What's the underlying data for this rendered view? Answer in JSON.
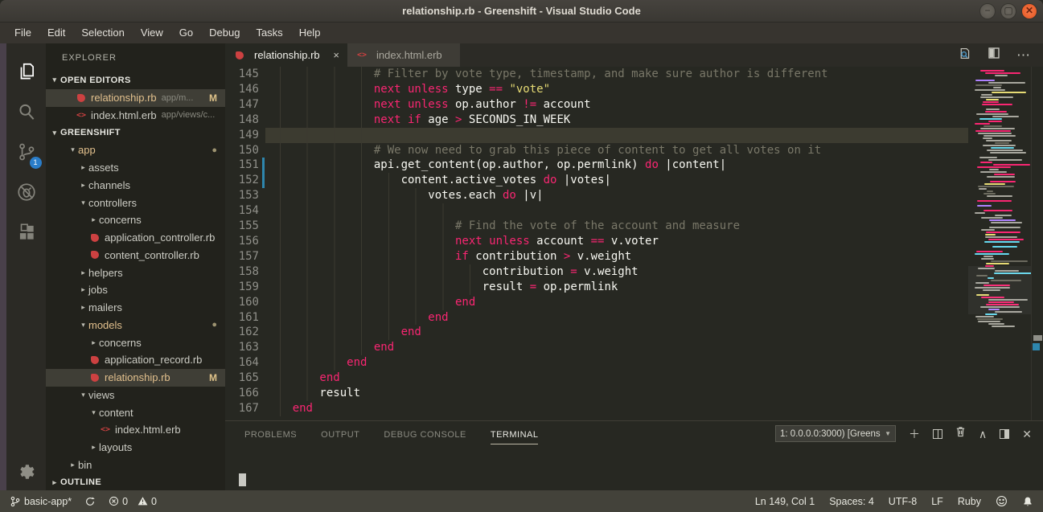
{
  "window": {
    "title": "relationship.rb - Greenshift - Visual Studio Code"
  },
  "menu": {
    "items": [
      "File",
      "Edit",
      "Selection",
      "View",
      "Go",
      "Debug",
      "Tasks",
      "Help"
    ]
  },
  "activity_bar": {
    "scm_badge": "1"
  },
  "sidebar": {
    "title": "EXPLORER",
    "open_editors": {
      "header": "OPEN EDITORS",
      "items": [
        {
          "name": "relationship.rb",
          "path": "app/m...",
          "badge": "M",
          "icon": "ruby",
          "active": true,
          "modified": true
        },
        {
          "name": "index.html.erb",
          "path": "app/views/c...",
          "icon": "erb"
        }
      ]
    },
    "project": {
      "header": "GREENSHIFT",
      "tree": [
        {
          "label": "app",
          "level": 1,
          "kind": "folder-open",
          "modified": true,
          "dot": "●"
        },
        {
          "label": "assets",
          "level": 2,
          "kind": "folder"
        },
        {
          "label": "channels",
          "level": 2,
          "kind": "folder"
        },
        {
          "label": "controllers",
          "level": 2,
          "kind": "folder-open"
        },
        {
          "label": "concerns",
          "level": 3,
          "kind": "folder"
        },
        {
          "label": "application_controller.rb",
          "level": 3,
          "kind": "ruby"
        },
        {
          "label": "content_controller.rb",
          "level": 3,
          "kind": "ruby"
        },
        {
          "label": "helpers",
          "level": 2,
          "kind": "folder"
        },
        {
          "label": "jobs",
          "level": 2,
          "kind": "folder"
        },
        {
          "label": "mailers",
          "level": 2,
          "kind": "folder"
        },
        {
          "label": "models",
          "level": 2,
          "kind": "folder-open",
          "modified": true,
          "dot": "●"
        },
        {
          "label": "concerns",
          "level": 3,
          "kind": "folder"
        },
        {
          "label": "application_record.rb",
          "level": 3,
          "kind": "ruby"
        },
        {
          "label": "relationship.rb",
          "level": 3,
          "kind": "ruby",
          "modified": true,
          "badge": "M",
          "selected": true
        },
        {
          "label": "views",
          "level": 2,
          "kind": "folder-open"
        },
        {
          "label": "content",
          "level": 3,
          "kind": "folder-open"
        },
        {
          "label": "index.html.erb",
          "level": 4,
          "kind": "erb"
        },
        {
          "label": "layouts",
          "level": 3,
          "kind": "folder"
        },
        {
          "label": "bin",
          "level": 1,
          "kind": "folder"
        }
      ]
    },
    "outline": {
      "header": "OUTLINE"
    }
  },
  "tabs": [
    {
      "label": "relationship.rb",
      "icon": "ruby",
      "close": "×",
      "active": true
    },
    {
      "label": "index.html.erb",
      "icon": "erb",
      "active": false
    }
  ],
  "editor": {
    "lines": [
      {
        "n": 145,
        "i": 16,
        "segs": [
          [
            "c",
            "# Filter by vote type, timestamp, and make sure author is different"
          ]
        ]
      },
      {
        "n": 146,
        "i": 16,
        "segs": [
          [
            "k",
            "next unless"
          ],
          [
            "t",
            " type "
          ],
          [
            "k",
            "=="
          ],
          [
            "t",
            " "
          ],
          [
            "s",
            "\"vote\""
          ]
        ]
      },
      {
        "n": 147,
        "i": 16,
        "segs": [
          [
            "k",
            "next unless"
          ],
          [
            "t",
            " op.author "
          ],
          [
            "k",
            "!="
          ],
          [
            "t",
            " account"
          ]
        ]
      },
      {
        "n": 148,
        "i": 16,
        "segs": [
          [
            "k",
            "next if"
          ],
          [
            "t",
            " age "
          ],
          [
            "k",
            ">"
          ],
          [
            "t",
            " SECONDS_IN_WEEK"
          ]
        ]
      },
      {
        "n": 149,
        "i": 16,
        "cur": true,
        "segs": []
      },
      {
        "n": 150,
        "i": 16,
        "segs": [
          [
            "c",
            "# We now need to grab this piece of content to get all votes on it"
          ]
        ]
      },
      {
        "n": 151,
        "i": 16,
        "segs": [
          [
            "t",
            "api.get_content(op.author, op.permlink) "
          ],
          [
            "k",
            "do"
          ],
          [
            "t",
            " |content|"
          ]
        ]
      },
      {
        "n": 152,
        "i": 20,
        "segs": [
          [
            "t",
            "content.active_votes "
          ],
          [
            "k",
            "do"
          ],
          [
            "t",
            " |votes|"
          ]
        ]
      },
      {
        "n": 153,
        "i": 24,
        "segs": [
          [
            "t",
            "votes.each "
          ],
          [
            "k",
            "do"
          ],
          [
            "t",
            " |v|"
          ]
        ]
      },
      {
        "n": 154,
        "i": 28,
        "segs": []
      },
      {
        "n": 155,
        "i": 28,
        "segs": [
          [
            "c",
            "# Find the vote of the account and measure"
          ]
        ]
      },
      {
        "n": 156,
        "i": 28,
        "segs": [
          [
            "k",
            "next unless"
          ],
          [
            "t",
            " account "
          ],
          [
            "k",
            "=="
          ],
          [
            "t",
            " v.voter"
          ]
        ]
      },
      {
        "n": 157,
        "i": 28,
        "segs": [
          [
            "k",
            "if"
          ],
          [
            "t",
            " contribution "
          ],
          [
            "k",
            ">"
          ],
          [
            "t",
            " v.weight"
          ]
        ]
      },
      {
        "n": 158,
        "i": 32,
        "segs": [
          [
            "t",
            "contribution "
          ],
          [
            "k",
            "="
          ],
          [
            "t",
            " v.weight"
          ]
        ]
      },
      {
        "n": 159,
        "i": 32,
        "segs": [
          [
            "t",
            "result "
          ],
          [
            "k",
            "="
          ],
          [
            "t",
            " op.permlink"
          ]
        ]
      },
      {
        "n": 160,
        "i": 28,
        "segs": [
          [
            "k",
            "end"
          ]
        ]
      },
      {
        "n": 161,
        "i": 24,
        "segs": [
          [
            "k",
            "end"
          ]
        ]
      },
      {
        "n": 162,
        "i": 20,
        "segs": [
          [
            "k",
            "end"
          ]
        ]
      },
      {
        "n": 163,
        "i": 16,
        "segs": [
          [
            "k",
            "end"
          ]
        ]
      },
      {
        "n": 164,
        "i": 12,
        "segs": [
          [
            "k",
            "end"
          ]
        ]
      },
      {
        "n": 165,
        "i": 8,
        "segs": [
          [
            "k",
            "end"
          ]
        ]
      },
      {
        "n": 166,
        "i": 8,
        "segs": [
          [
            "t",
            "result"
          ]
        ]
      },
      {
        "n": 167,
        "i": 4,
        "segs": [
          [
            "k",
            "end"
          ]
        ]
      }
    ]
  },
  "panel": {
    "tabs": [
      {
        "label": "PROBLEMS",
        "active": false
      },
      {
        "label": "OUTPUT",
        "active": false
      },
      {
        "label": "DEBUG CONSOLE",
        "active": false
      },
      {
        "label": "TERMINAL",
        "active": true
      }
    ],
    "terminal_select": "1: 0.0.0.0:3000) [Greens",
    "select_caret": "▼"
  },
  "status_bar": {
    "branch": "basic-app*",
    "errors": "0",
    "warnings": "0",
    "right_items": [
      "Ln 149, Col 1",
      "Spaces: 4",
      "UTF-8",
      "LF",
      "Ruby"
    ]
  },
  "icons": {
    "close_tab": "×",
    "more": "⋯",
    "plus": "＋",
    "chevron_up": "∧",
    "close_panel": "✕",
    "twisty_open": "▾",
    "twisty_closed": "▸",
    "smiley": "☺"
  },
  "colors": {
    "keyword": "#f92672",
    "string": "#e6db74",
    "comment": "#797768",
    "text": "#f8f8f2",
    "modified_gold": "#e2c08d",
    "git_blue": "#2e86ad",
    "badge_blue": "#2a7dc9",
    "editor_bg": "#272822",
    "sidebar_bg": "#22221c",
    "status_bg": "#43423a",
    "ruby_red": "#cc4141",
    "minimap_palette": [
      "#a8a79e",
      "#f92672",
      "#6b6a5e",
      "#e6db74",
      "#66d9ef",
      "#ae81ff"
    ]
  }
}
